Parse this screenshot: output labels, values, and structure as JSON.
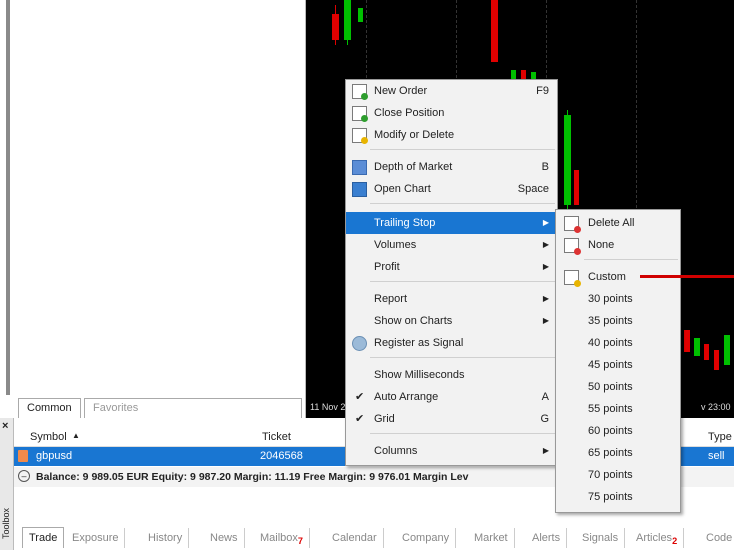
{
  "navigator": {
    "tabs": [
      "Common",
      "Favorites"
    ]
  },
  "chart": {
    "time_labels": [
      "11 Nov 2",
      "v 23:00"
    ]
  },
  "toolbox": {
    "side_label": "Toolbox",
    "close": "×",
    "columns": {
      "symbol": "Symbol",
      "sort": "▲",
      "ticket": "Ticket",
      "type": "Type"
    },
    "row": {
      "symbol": "gbpusd",
      "ticket": "2046568",
      "type": "sell"
    },
    "balance": "Balance: 9 989.05 EUR  Equity: 9 987.20  Margin: 11.19  Free Margin: 9 976.01  Margin Lev",
    "tabs": [
      {
        "label": "Trade"
      },
      {
        "label": "Exposure"
      },
      {
        "label": "History"
      },
      {
        "label": "News"
      },
      {
        "label": "Mailbox",
        "badge": "7"
      },
      {
        "label": "Calendar"
      },
      {
        "label": "Company"
      },
      {
        "label": "Market"
      },
      {
        "label": "Alerts"
      },
      {
        "label": "Signals"
      },
      {
        "label": "Articles",
        "badge": "2"
      },
      {
        "label": "Code"
      }
    ]
  },
  "context_menu": {
    "new_order": "New Order",
    "new_order_sc": "F9",
    "close_position": "Close Position",
    "modify_delete": "Modify or Delete",
    "depth": "Depth of Market",
    "depth_sc": "B",
    "open_chart": "Open Chart",
    "open_chart_sc": "Space",
    "trailing": "Trailing Stop",
    "volumes": "Volumes",
    "profit": "Profit",
    "report": "Report",
    "show_on_charts": "Show on Charts",
    "register_signal": "Register as Signal",
    "show_ms": "Show Milliseconds",
    "auto_arrange": "Auto Arrange",
    "auto_arrange_sc": "A",
    "grid": "Grid",
    "grid_sc": "G",
    "columns": "Columns"
  },
  "submenu": {
    "delete_all": "Delete All",
    "none": "None",
    "custom": "Custom",
    "points": [
      "30 points",
      "35 points",
      "40 points",
      "45 points",
      "50 points",
      "55 points",
      "60 points",
      "65 points",
      "70 points",
      "75 points"
    ]
  },
  "colors": {
    "selection": "#1976d2",
    "up_candle": "#00c000",
    "down_candle": "#e00000",
    "annotation": "#d00000"
  }
}
